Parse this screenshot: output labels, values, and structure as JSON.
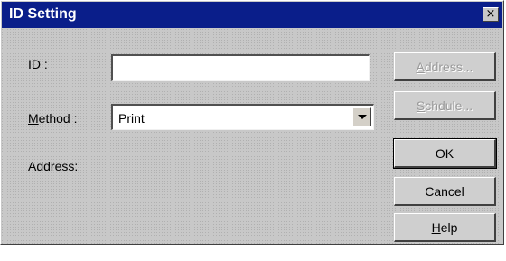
{
  "window": {
    "title": "ID Setting",
    "close_glyph": "×"
  },
  "form": {
    "id_label_mnemonic": "I",
    "id_label_rest": "D :",
    "id_value": "",
    "method_label_mnemonic": "M",
    "method_label_rest": "ethod :",
    "method_value": "Print",
    "address_label": "Address:"
  },
  "buttons": {
    "address": "Address...",
    "address_mnemonic": "A",
    "address_enabled": false,
    "schedule": "Schdule...",
    "schedule_mnemonic": "S",
    "schedule_enabled": false,
    "ok": "OK",
    "cancel": "Cancel",
    "help_mnemonic": "H",
    "help_rest": "elp"
  },
  "icons": {
    "close": "close-icon",
    "dropdown": "chevron-down-icon"
  },
  "colors": {
    "titlebar": "#0a1e8a",
    "face": "#c8c8c8",
    "disabled_text": "#9a9a9a"
  }
}
